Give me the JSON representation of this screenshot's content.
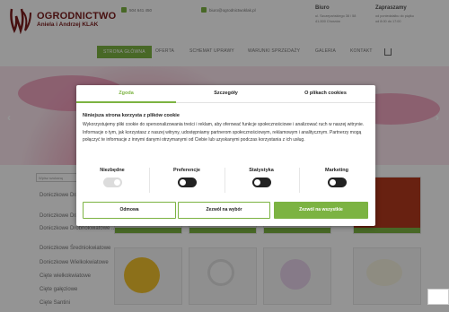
{
  "header": {
    "brand_title": "OGRODNICTWO",
    "brand_subtitle": "Aniela i Andrzej KLAK",
    "phone": "504 641 450",
    "email": "biuro@ogrodnictwoklak.pl",
    "locations": [
      {
        "heading": "Biuro",
        "lines": [
          "ul. Szczepańskiego 38 / 58",
          "41-500 Chorzów"
        ]
      },
      {
        "heading": "Zapraszamy",
        "lines": [
          "od poniedziałku do piątku",
          "od 8:00 do 17:00"
        ]
      }
    ]
  },
  "nav": {
    "items": [
      "STRONA GŁÓWNA",
      "OFERTA",
      "SCHEMAT UPRAWY",
      "WARUNKI SPRZEDAŻY",
      "GALERIA",
      "KONTAKT"
    ],
    "active_index": 0
  },
  "sidebar": {
    "search_placeholder": "Wpisz szukaną",
    "items": [
      "Doniczkowe Draceny KLAK",
      "Doniczkowe Dra...",
      "Doniczkowe Drobnokwiatowe ...",
      "Doniczkowe Średniokwiatowe",
      "Doniczkowe Wielkokwiatowe",
      "Cięte wielkokwiatowe",
      "Cięte gałęziowe",
      "Cięte Santini"
    ]
  },
  "cookie_modal": {
    "tabs": [
      "Zgoda",
      "Szczegóły",
      "O plikach cookies"
    ],
    "active_tab": 0,
    "title": "Niniejsza strona korzysta z plików cookie",
    "body": "Wykorzystujemy pliki cookie do spersonalizowania treści i reklam, aby oferować funkcje społecznościowe i analizować ruch w naszej witrynie. Informacje o tym, jak korzystasz z naszej witryny, udostępniamy partnerom społecznościowym, reklamowym i analitycznym. Partnerzy mogą połączyć te informacje z innymi danymi otrzymanymi od Ciebie lub uzyskanymi podczas korzystania z ich usług.",
    "categories": [
      {
        "label": "Niezbędne",
        "enabled": true
      },
      {
        "label": "Preferencje",
        "enabled": false
      },
      {
        "label": "Statystyka",
        "enabled": false
      },
      {
        "label": "Marketing",
        "enabled": false
      }
    ],
    "buttons": {
      "decline": "Odmowa",
      "allow_selection": "Zezwól na wybór",
      "allow_all": "Zezwól na wszystkie"
    }
  },
  "colors": {
    "accent": "#7cb342",
    "brand": "#7a1d1d"
  }
}
